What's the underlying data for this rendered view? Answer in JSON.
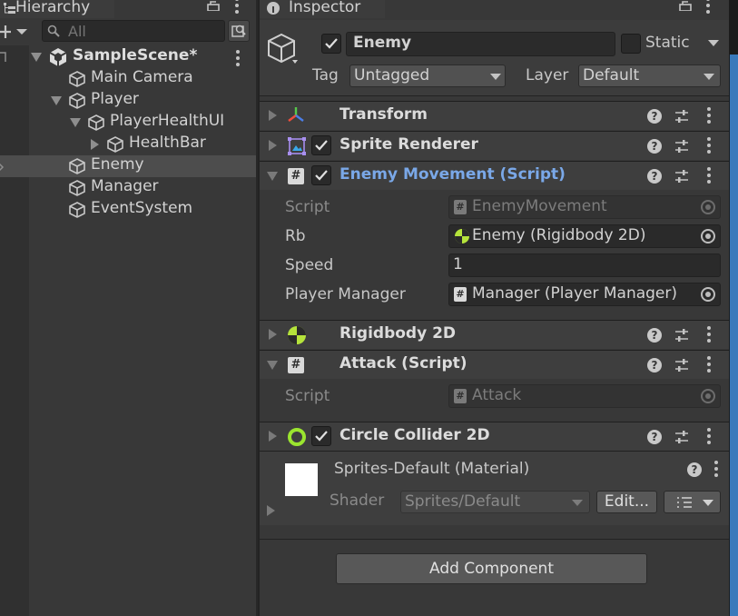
{
  "hierarchy": {
    "tab_title": "Hierarchy",
    "search": {
      "placeholder": "All",
      "value": ""
    },
    "scene": "SampleScene*",
    "items": [
      {
        "label": "Main Camera"
      },
      {
        "label": "Player"
      },
      {
        "label": "PlayerHealthUI"
      },
      {
        "label": "HealthBar"
      },
      {
        "label": "Enemy"
      },
      {
        "label": "Manager"
      },
      {
        "label": "EventSystem"
      }
    ]
  },
  "inspector": {
    "tab_title": "Inspector",
    "object_name": "Enemy",
    "static_label": "Static",
    "tag_label": "Tag",
    "tag_value": "Untagged",
    "layer_label": "Layer",
    "layer_value": "Default",
    "components": {
      "transform": "Transform",
      "sprite_renderer": "Sprite Renderer",
      "enemy_movement": "Enemy Movement (Script)",
      "rigidbody": "Rigidbody 2D",
      "attack": "Attack (Script)",
      "circle_collider": "Circle Collider 2D"
    },
    "enemy_movement_fields": {
      "script_label": "Script",
      "script_value": "EnemyMovement",
      "rb_label": "Rb",
      "rb_value": "Enemy (Rigidbody 2D)",
      "speed_label": "Speed",
      "speed_value": "1",
      "pm_label": "Player Manager",
      "pm_value": "Manager (Player Manager)"
    },
    "attack_fields": {
      "script_label": "Script",
      "script_value": "Attack"
    },
    "material": {
      "name": "Sprites-Default (Material)",
      "shader_label": "Shader",
      "shader_value": "Sprites/Default",
      "edit_label": "Edit..."
    },
    "add_component_label": "Add Component"
  },
  "colors": {
    "script_title_blue": "#7aa8e8",
    "selection_bar": "#4d4d4d",
    "rigidbody_icon": "#b5e33b",
    "collider_icon": "#9be52f",
    "transform_red": "#ef4d3c",
    "transform_green": "#57c84b",
    "transform_blue": "#4b7ee8"
  }
}
